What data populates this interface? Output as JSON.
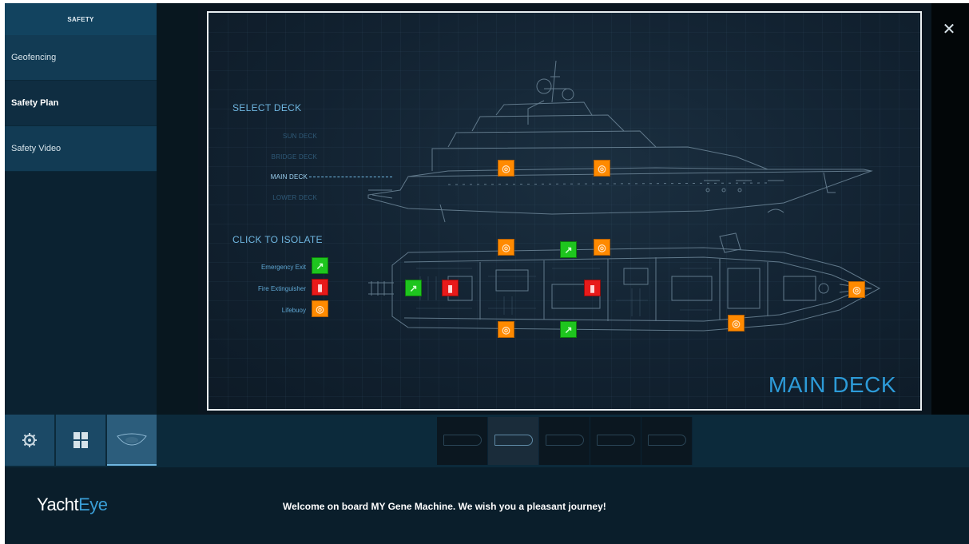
{
  "sidebar": {
    "header": "SAFETY",
    "items": [
      {
        "label": "Geofencing"
      },
      {
        "label": "Safety Plan"
      },
      {
        "label": "Safety Video"
      }
    ]
  },
  "viewer": {
    "select_deck_title": "SELECT DECK",
    "decks": [
      "SUN DECK",
      "BRIDGE DECK",
      "MAIN DECK",
      "LOWER DECK"
    ],
    "selected_deck": "MAIN DECK",
    "isolate_title": "CLICK TO ISOLATE",
    "legend": [
      {
        "label": "Emergency Exit",
        "icon": "emergency-exit-icon",
        "color": "#1ec51e"
      },
      {
        "label": "Fire Extinguisher",
        "icon": "fire-extinguisher-icon",
        "color": "#e81a1a"
      },
      {
        "label": "Lifebuoy",
        "icon": "lifebuoy-icon",
        "color": "#ff8a00"
      }
    ],
    "deck_title": "MAIN DECK",
    "close_icon": "close-icon"
  },
  "toolbar": {
    "buttons": [
      {
        "icon": "settings-icon"
      },
      {
        "icon": "grid-icon"
      },
      {
        "icon": "eye-icon"
      }
    ],
    "thumbnails": [
      "sun-deck-thumbnail",
      "main-deck-thumbnail",
      "deck-thumbnail-3",
      "deck-thumbnail-4",
      "deck-thumbnail-5"
    ]
  },
  "footer": {
    "logo_part1": "Yacht",
    "logo_part2": "Eye",
    "welcome": "Welcome on board MY Gene Machine. We wish you a pleasant journey!"
  }
}
